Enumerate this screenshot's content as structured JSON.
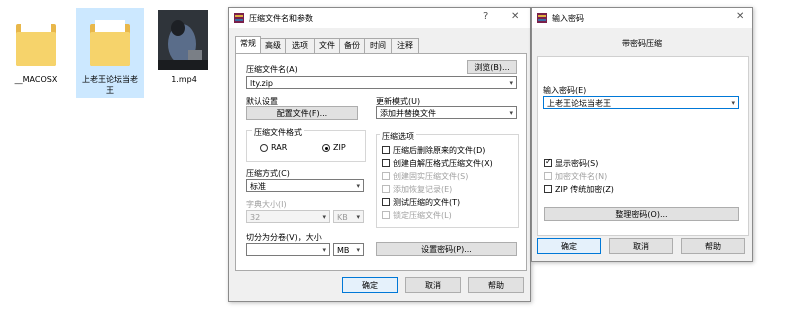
{
  "desktop": {
    "files": [
      {
        "label": "__MACOSX"
      },
      {
        "label": "上老王论坛当老王"
      },
      {
        "label": "1.mp4"
      }
    ]
  },
  "archive_dialog": {
    "title": "压缩文件名和参数",
    "help_glyph": "?",
    "close_glyph": "✕",
    "tabs": [
      "常规",
      "高级",
      "选项",
      "文件",
      "备份",
      "时间",
      "注释"
    ],
    "active_tab": "常规",
    "archive_name_label": "压缩文件名(A)",
    "browse_button": "浏览(B)...",
    "archive_name_value": "lty.zip",
    "default_settings_label": "默认设置",
    "profile_button": "配置文件(F)...",
    "update_mode_label": "更新模式(U)",
    "update_mode_value": "添加并替换文件",
    "format_group_label": "压缩文件格式",
    "format_rar": "RAR",
    "format_zip": "ZIP",
    "selected_format": "ZIP",
    "options_group_label": "压缩选项",
    "options": [
      {
        "label": "压缩后删除原来的文件(D)",
        "checked": false,
        "enabled": true
      },
      {
        "label": "创建自解压格式压缩文件(X)",
        "checked": false,
        "enabled": true
      },
      {
        "label": "创建固实压缩文件(S)",
        "checked": false,
        "enabled": false
      },
      {
        "label": "添加恢复记录(E)",
        "checked": false,
        "enabled": false
      },
      {
        "label": "测试压缩的文件(T)",
        "checked": false,
        "enabled": true
      },
      {
        "label": "锁定压缩文件(L)",
        "checked": false,
        "enabled": false
      }
    ],
    "method_label": "压缩方式(C)",
    "method_value": "标准",
    "dict_label": "字典大小(I)",
    "dict_value": "32",
    "dict_unit": "KB",
    "split_label": "切分为分卷(V)，大小",
    "split_value": "",
    "split_unit": "MB",
    "set_password_button": "设置密码(P)...",
    "ok_button": "确定",
    "cancel_button": "取消",
    "help_button": "帮助"
  },
  "password_dialog": {
    "title": "输入密码",
    "close_glyph": "✕",
    "heading": "带密码压缩",
    "password_label": "输入密码(E)",
    "password_value": "上老王论坛当老王",
    "show_password_label": "显示密码(S)",
    "show_password_checked": true,
    "encrypt_names_label": "加密文件名(N)",
    "encrypt_names_enabled": false,
    "zip_legacy_label": "ZIP 传统加密(Z)",
    "zip_legacy_checked": false,
    "organize_button": "整理密码(O)...",
    "ok_button": "确定",
    "cancel_button": "取消",
    "help_button": "帮助"
  }
}
